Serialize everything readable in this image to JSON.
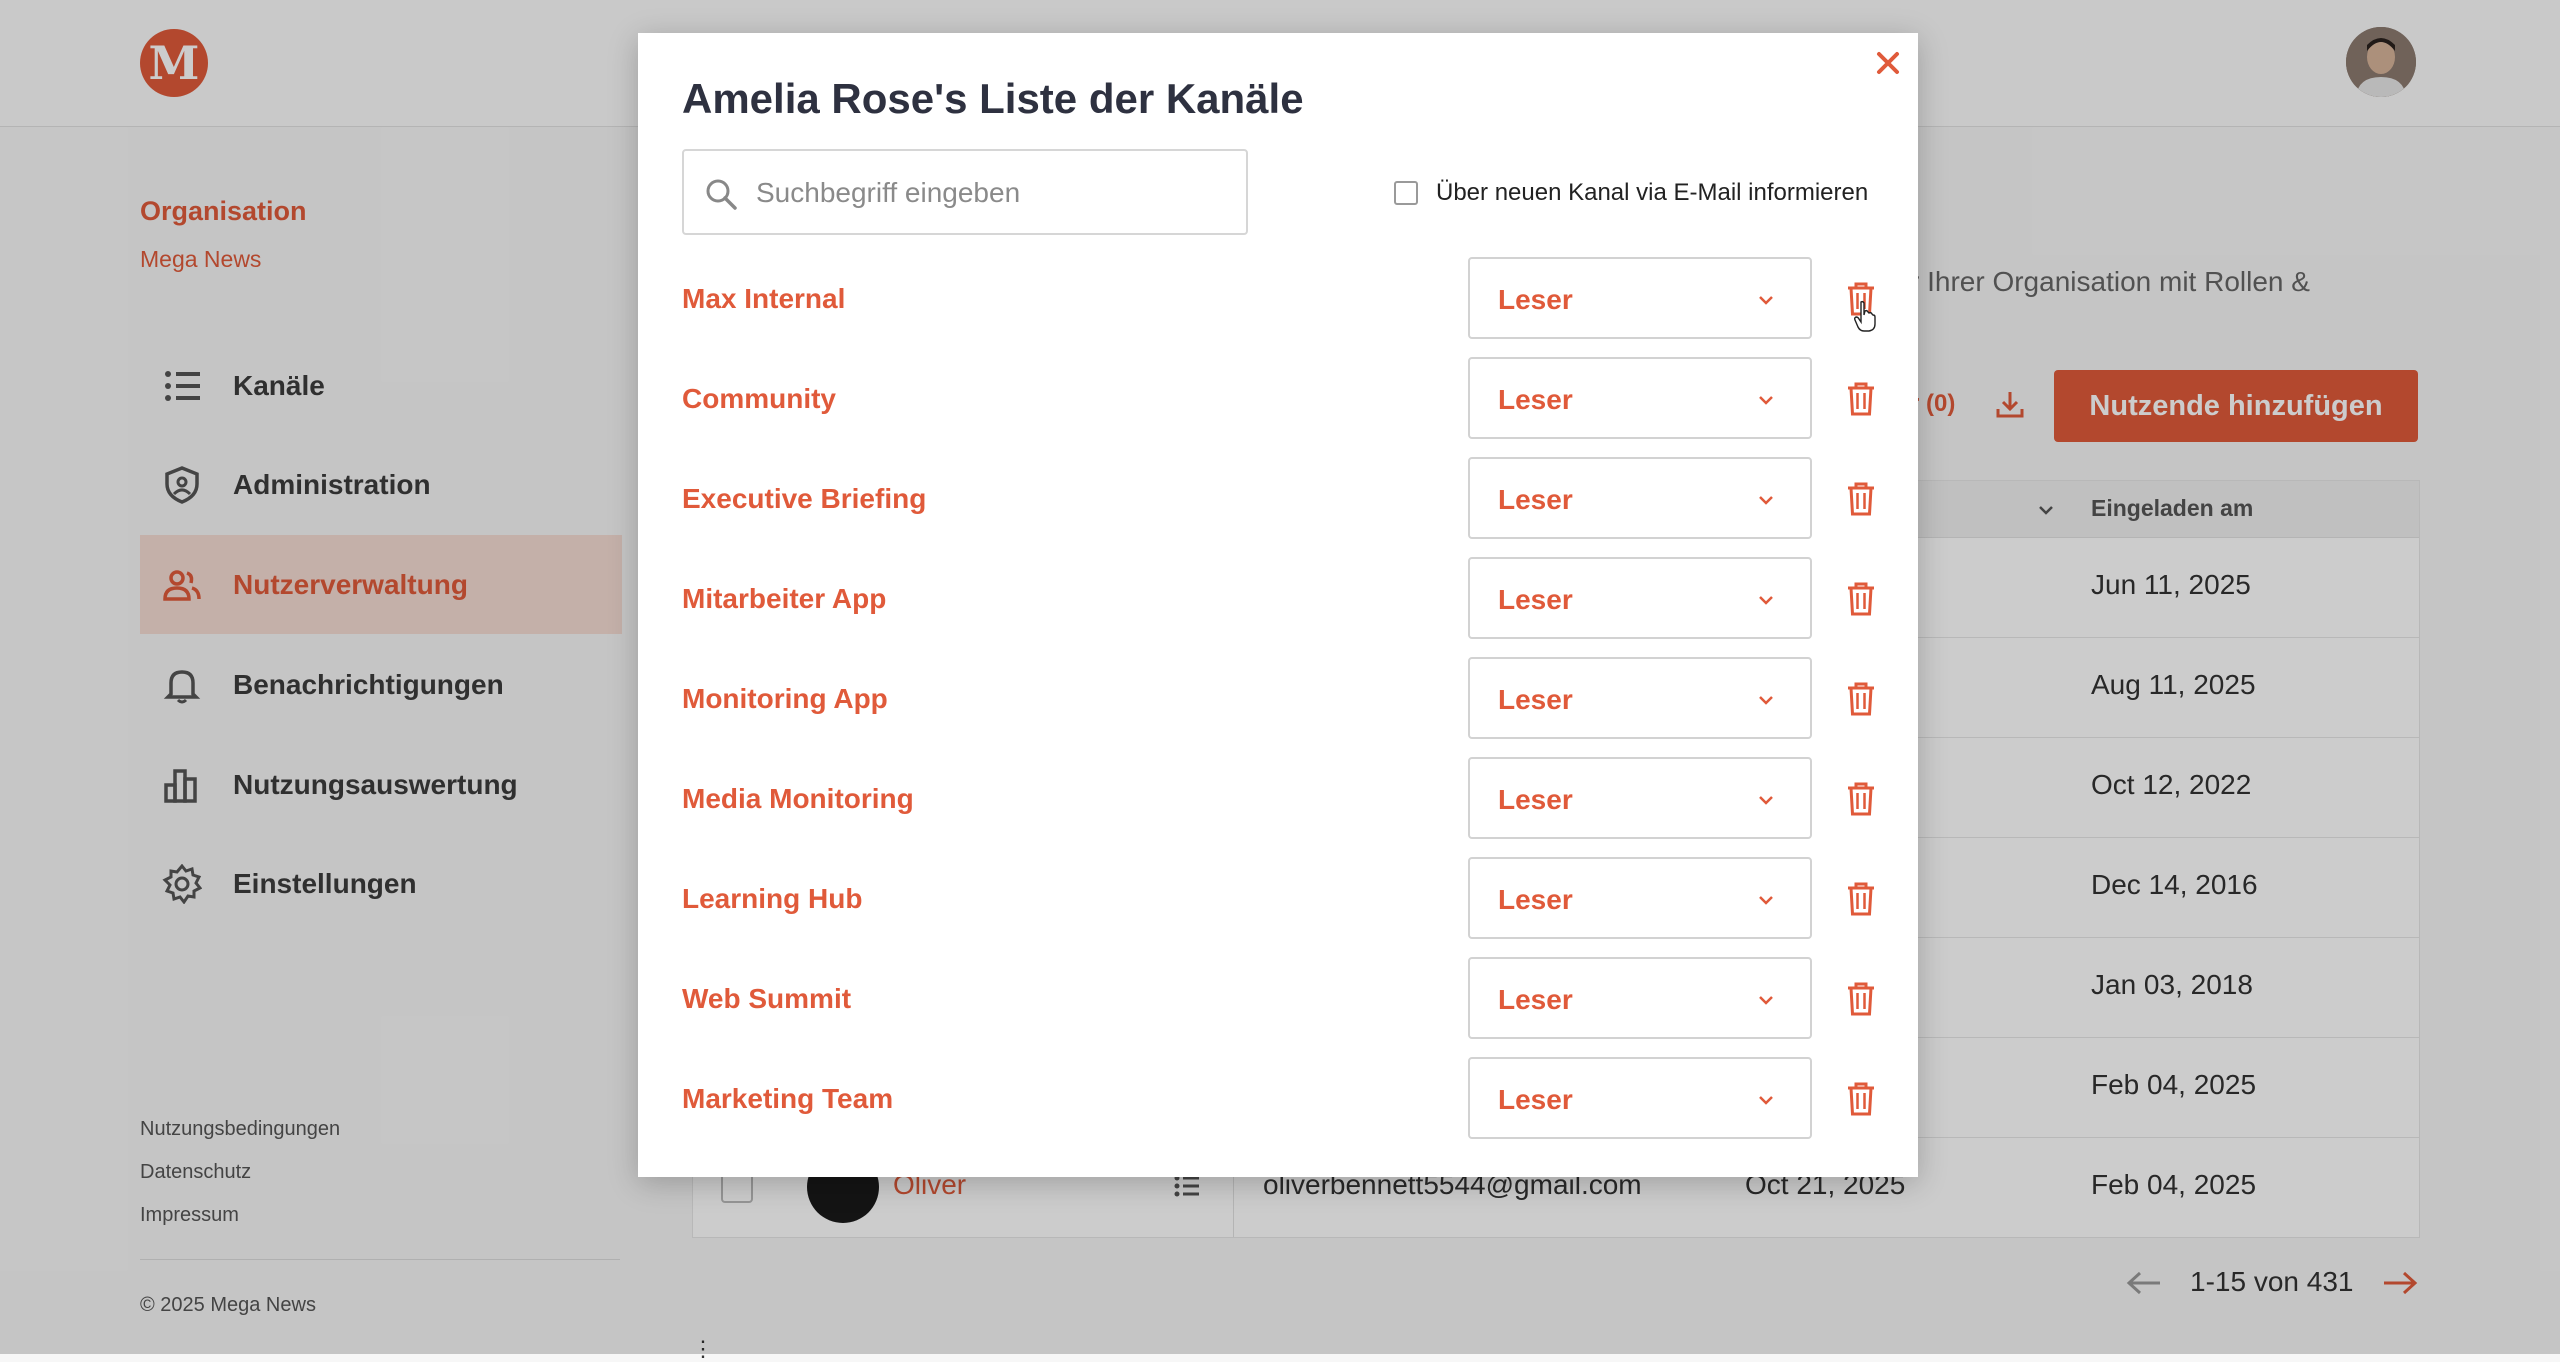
{
  "brand": {
    "logo_letter": "M"
  },
  "sidebar": {
    "org_title": "Organisation",
    "org_name": "Mega News",
    "items": [
      {
        "label": "Kanäle",
        "icon": "list-icon"
      },
      {
        "label": "Administration",
        "icon": "shield-icon"
      },
      {
        "label": "Nutzerverwaltung",
        "icon": "users-icon",
        "active": true
      },
      {
        "label": "Benachrichtigungen",
        "icon": "bell-icon"
      },
      {
        "label": "Nutzungsauswertung",
        "icon": "bar-chart-icon"
      },
      {
        "label": "Einstellungen",
        "icon": "gear-icon"
      }
    ],
    "footer": [
      "Nutzungsbedingungen",
      "Datenschutz",
      "Impressum"
    ],
    "copyright": "© 2025 Mega News"
  },
  "main": {
    "description_fragment": "r Ihrer Organisation mit Rollen &",
    "filter_fragment": "r (0)",
    "add_button": "Nutzende hinzufügen",
    "table": {
      "invited_header": "Eingeladen am",
      "rows": [
        {
          "invited": "Jun 11, 2025"
        },
        {
          "invited": "Aug 11, 2025"
        },
        {
          "invited": "Oct 12, 2022"
        },
        {
          "invited": "Dec 14, 2016"
        },
        {
          "invited": "Jan 03, 2018"
        },
        {
          "invited": "Feb 04, 2025"
        },
        {
          "name": "Oliver",
          "email": "oliverbennett5544@gmail.com",
          "date": "Oct 21, 2025",
          "invited": "Feb 04, 2025"
        }
      ]
    },
    "pagination": {
      "text": "1-15 von 431"
    }
  },
  "modal": {
    "title": "Amelia Rose's Liste der Kanäle",
    "search_placeholder": "Suchbegriff eingeben",
    "search_value": "",
    "notify_label": "Über neuen Kanal via E-Mail informieren",
    "notify_checked": false,
    "channels": [
      {
        "name": "Max Internal",
        "role": "Leser"
      },
      {
        "name": "Community",
        "role": "Leser"
      },
      {
        "name": "Executive Briefing",
        "role": "Leser"
      },
      {
        "name": "Mitarbeiter App",
        "role": "Leser"
      },
      {
        "name": "Monitoring App",
        "role": "Leser"
      },
      {
        "name": "Media Monitoring",
        "role": "Leser"
      },
      {
        "name": "Learning Hub",
        "role": "Leser"
      },
      {
        "name": "Web Summit",
        "role": "Leser"
      },
      {
        "name": "Marketing Team",
        "role": "Leser"
      }
    ]
  },
  "colors": {
    "accent": "#e05a3a",
    "active_nav_bg": "#f5dcd4",
    "text_dark": "#2e3140"
  }
}
